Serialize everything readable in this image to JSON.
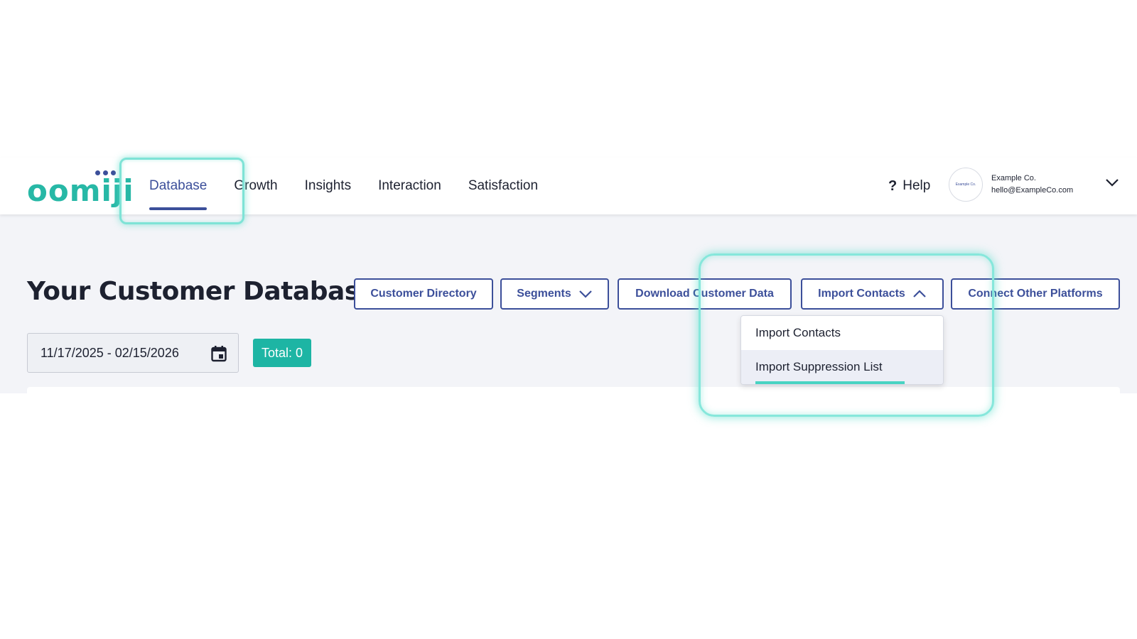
{
  "logo": {
    "text": "oomiji"
  },
  "nav": {
    "items": [
      {
        "label": "Database"
      },
      {
        "label": "Growth"
      },
      {
        "label": "Insights"
      },
      {
        "label": "Interaction"
      },
      {
        "label": "Satisfaction"
      }
    ],
    "active": "Database"
  },
  "header": {
    "help_label": "Help",
    "help_icon": "?",
    "account": {
      "avatar_text": "Example Co.",
      "name": "Example Co.",
      "email": "hello@ExampleCo.com"
    }
  },
  "page": {
    "title": "Your Customer Database",
    "buttons": {
      "customer_directory": "Customer Directory",
      "segments": "Segments",
      "download": "Download Customer Data",
      "import_contacts": "Import Contacts",
      "connect": "Connect Other Platforms"
    },
    "date_range": "11/17/2025 - 02/15/2026",
    "total": "Total: 0"
  },
  "import_menu": {
    "items": [
      {
        "label": "Import Contacts"
      },
      {
        "label": "Import Suppression List"
      }
    ],
    "hovered": "Import Suppression List"
  },
  "colors": {
    "brand_teal": "#27b8a6",
    "primary_blue": "#3c4f9a",
    "badge_teal": "#1db5a4",
    "highlight": "#86e7db"
  }
}
